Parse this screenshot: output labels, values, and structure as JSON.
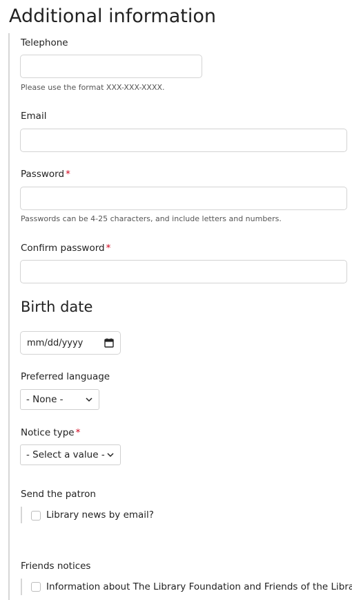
{
  "section": {
    "title": "Additional information"
  },
  "telephone": {
    "label": "Telephone",
    "value": "",
    "help": "Please use the format XXX-XXX-XXXX."
  },
  "email": {
    "label": "Email",
    "value": ""
  },
  "password": {
    "label": "Password",
    "required_mark": "*",
    "value": "",
    "help": "Passwords can be 4-25 characters, and include letters and numbers."
  },
  "confirm_password": {
    "label": "Confirm password",
    "required_mark": "*",
    "value": ""
  },
  "birth_date": {
    "title": "Birth date",
    "placeholder": "mm/dd/yyyy",
    "icon": "calendar-icon"
  },
  "preferred_language": {
    "label": "Preferred language",
    "selected": "- None -",
    "icon": "chevron-down-icon"
  },
  "notice_type": {
    "label": "Notice type",
    "required_mark": "*",
    "selected": "- Select a value -",
    "icon": "chevron-down-icon"
  },
  "send_patron": {
    "label": "Send the patron",
    "option": "Library news by email?",
    "checked": false
  },
  "friends_notices": {
    "label": "Friends notices",
    "option": "Information about The Library Foundation and Friends of the Library",
    "checked": false
  },
  "colors": {
    "required": "#d0021b",
    "border": "#d3d3d3",
    "rule": "#d6d6d6"
  }
}
